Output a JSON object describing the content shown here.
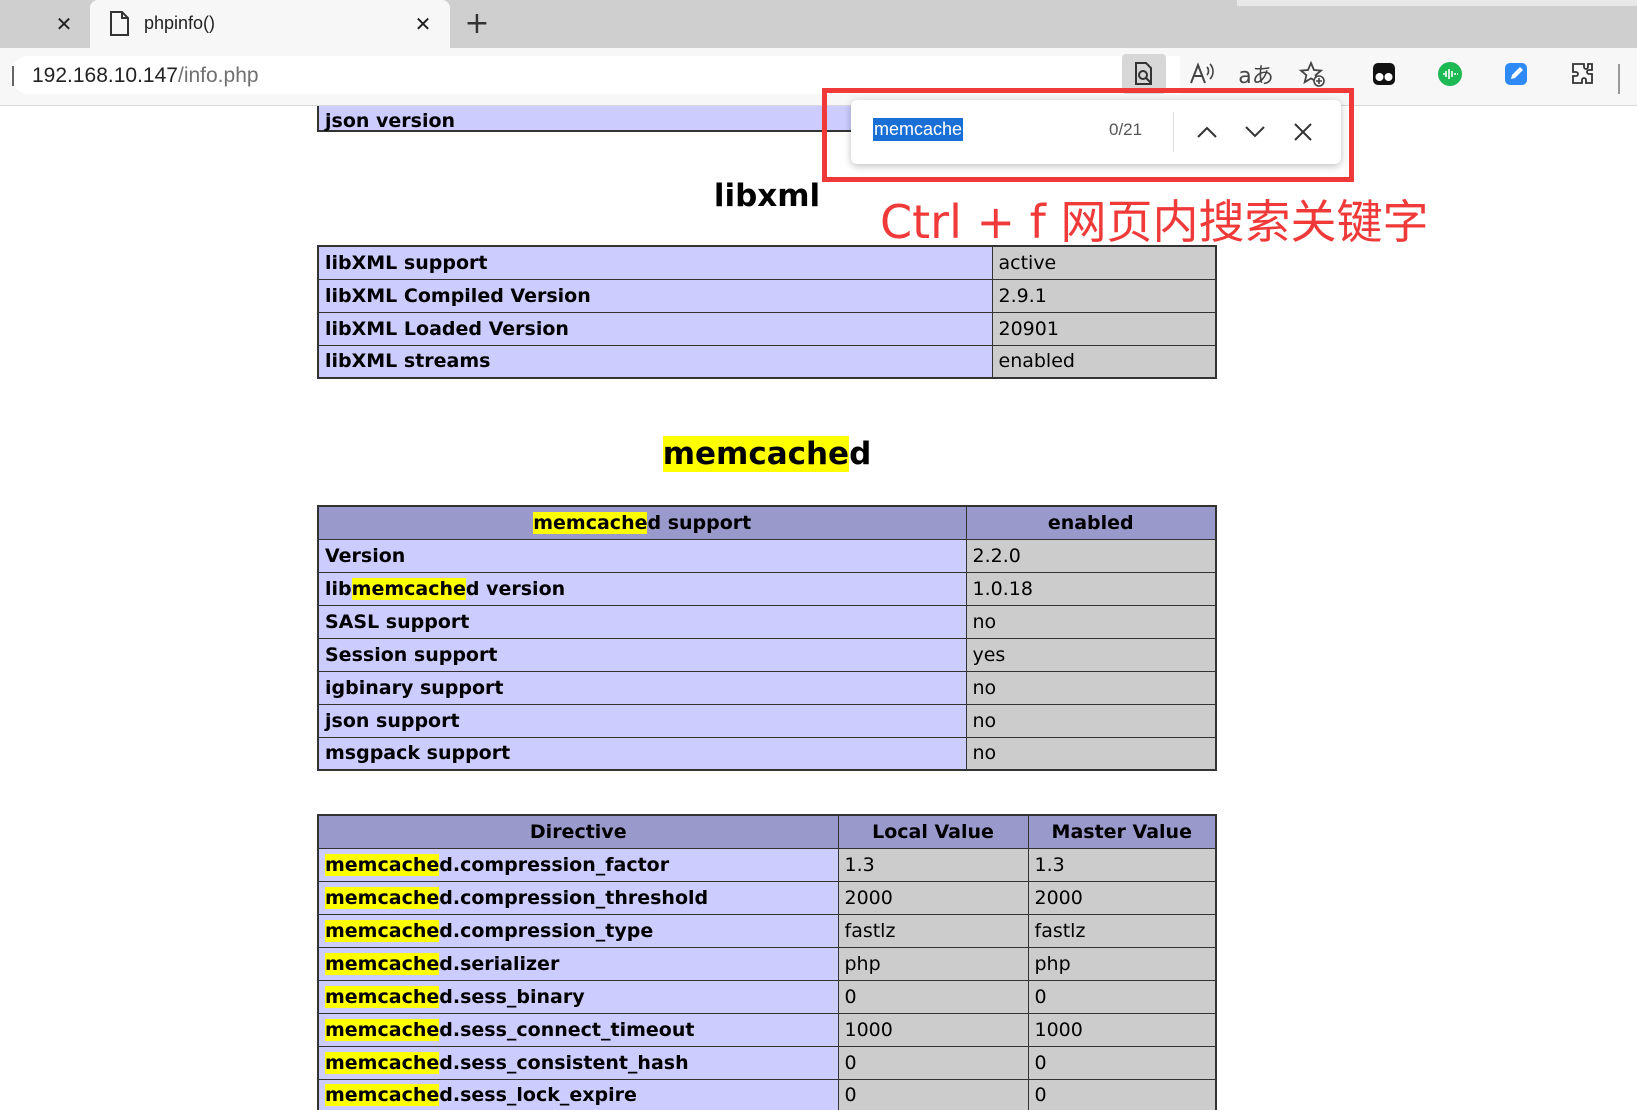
{
  "tabs": [
    {
      "title": "",
      "close": "✕"
    },
    {
      "title": "phpinfo()",
      "close": "✕"
    }
  ],
  "new_tab_symbol": "+",
  "address": {
    "host": "192.168.10.147",
    "path": "/info.php"
  },
  "toolbar_icons": [
    "find-in-page-icon",
    "read-aloud-icon",
    "translate-icon",
    "favorite-icon",
    "tampermonkey-icon",
    "green-extension-icon",
    "blue-extension-icon",
    "extensions-icon"
  ],
  "top_row_partial": "json version",
  "libxml": {
    "heading": "libxml",
    "rows": [
      {
        "k": "libXML support",
        "v": "active"
      },
      {
        "k": "libXML Compiled Version",
        "v": "2.9.1"
      },
      {
        "k": "libXML Loaded Version",
        "v": "20901"
      },
      {
        "k": "libXML streams",
        "v": "enabled"
      }
    ]
  },
  "memcached": {
    "heading_hl": "memcache",
    "heading_rest": "d",
    "header": {
      "k_hl": "memcache",
      "k_rest": "d support",
      "v": "enabled"
    },
    "rows": [
      {
        "k_pre": "Version",
        "k_hl": "",
        "k_rest": "",
        "v": "2.2.0"
      },
      {
        "k_pre": "lib",
        "k_hl": "memcache",
        "k_rest": "d version",
        "v": "1.0.18"
      },
      {
        "k_pre": "SASL support",
        "k_hl": "",
        "k_rest": "",
        "v": "no"
      },
      {
        "k_pre": "Session support",
        "k_hl": "",
        "k_rest": "",
        "v": "yes"
      },
      {
        "k_pre": "igbinary support",
        "k_hl": "",
        "k_rest": "",
        "v": "no"
      },
      {
        "k_pre": "json support",
        "k_hl": "",
        "k_rest": "",
        "v": "no"
      },
      {
        "k_pre": "msgpack support",
        "k_hl": "",
        "k_rest": "",
        "v": "no"
      }
    ]
  },
  "directives": {
    "columns": [
      "Directive",
      "Local Value",
      "Master Value"
    ],
    "prefix_hl": "memcache",
    "rows": [
      {
        "name": "d.compression_factor",
        "local": "1.3",
        "master": "1.3"
      },
      {
        "name": "d.compression_threshold",
        "local": "2000",
        "master": "2000"
      },
      {
        "name": "d.compression_type",
        "local": "fastlz",
        "master": "fastlz"
      },
      {
        "name": "d.serializer",
        "local": "php",
        "master": "php"
      },
      {
        "name": "d.sess_binary",
        "local": "0",
        "master": "0"
      },
      {
        "name": "d.sess_connect_timeout",
        "local": "1000",
        "master": "1000"
      },
      {
        "name": "d.sess_consistent_hash",
        "local": "0",
        "master": "0"
      },
      {
        "name": "d.sess_lock_expire",
        "local": "0",
        "master": "0"
      }
    ]
  },
  "findbar": {
    "query": "memcache",
    "count": "0/21"
  },
  "annotation": "Ctrl + f 网页内搜索关键字",
  "colors": {
    "find_highlight": "#ffff00",
    "annotation_red": "#f03a3a",
    "php_e": "#ccccff",
    "php_v": "#cccccc",
    "php_h": "#9999cc"
  }
}
